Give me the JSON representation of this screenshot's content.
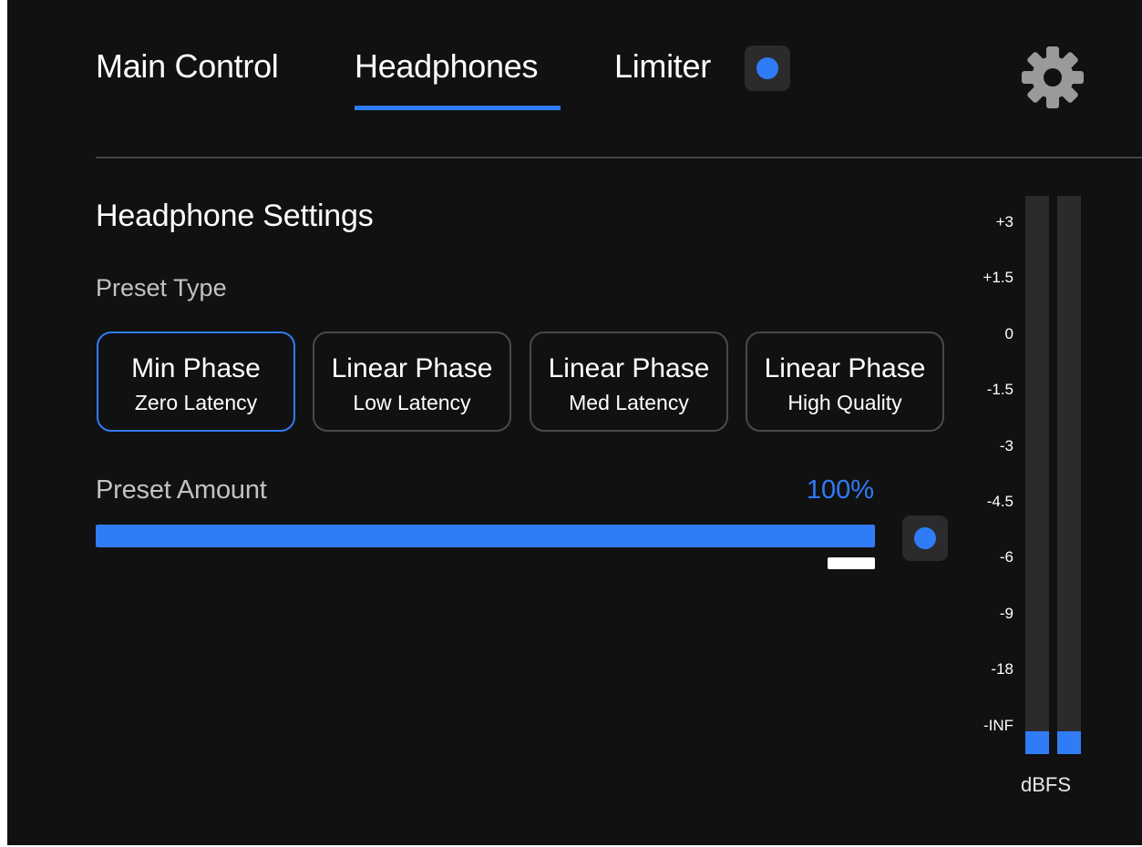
{
  "tabs": [
    {
      "label": "Main Control",
      "active": false
    },
    {
      "label": "Headphones",
      "active": true
    },
    {
      "label": "Limiter",
      "active": false
    }
  ],
  "limiter_toggle": {
    "enabled": true
  },
  "icons": {
    "settings": "gear-icon"
  },
  "section": {
    "title": "Headphone Settings"
  },
  "preset_type": {
    "label": "Preset Type",
    "options": [
      {
        "title": "Min Phase",
        "subtitle": "Zero Latency",
        "selected": true
      },
      {
        "title": "Linear Phase",
        "subtitle": "Low Latency",
        "selected": false
      },
      {
        "title": "Linear Phase",
        "subtitle": "Med Latency",
        "selected": false
      },
      {
        "title": "Linear Phase",
        "subtitle": "High Quality",
        "selected": false
      }
    ]
  },
  "preset_amount": {
    "label": "Preset Amount",
    "value_text": "100%",
    "value_fraction": 1.0,
    "default_fraction": 1.0,
    "toggle_enabled": true
  },
  "meter": {
    "unit": "dBFS",
    "scale": [
      "+3",
      "+1.5",
      "0",
      "-1.5",
      "-3",
      "-4.5",
      "-6",
      "-9",
      "-18",
      "-INF"
    ],
    "left_level_fraction": 0.04,
    "right_level_fraction": 0.04
  },
  "colors": {
    "accent": "#2f7cf6",
    "background": "#111111",
    "border": "#4a4a4a",
    "toggle_bg": "#2b2b2e",
    "secondary_text": "#c2c2c2"
  }
}
